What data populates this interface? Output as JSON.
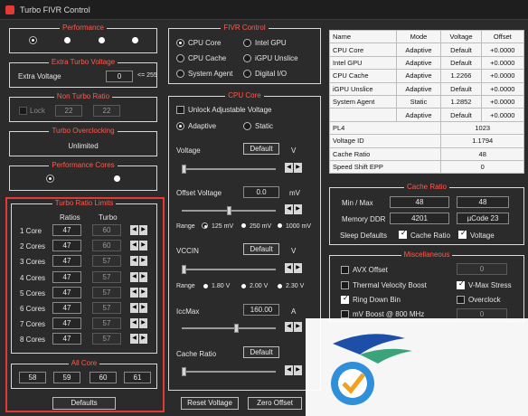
{
  "window": {
    "title": "Turbo FIVR Control"
  },
  "performance": {
    "title": "Performance"
  },
  "extra_turbo": {
    "title": "Extra Turbo Voltage",
    "label": "Extra Voltage",
    "value": "0",
    "hint": "<= 255"
  },
  "non_turbo": {
    "title": "Non Turbo Ratio",
    "lock_label": "Lock",
    "values": [
      "22",
      "22"
    ]
  },
  "turbo_oc": {
    "title": "Turbo Overclocking",
    "value": "Unlimited"
  },
  "perf_cores": {
    "title": "Performance Cores"
  },
  "turbo_limits": {
    "title": "Turbo Ratio Limits",
    "col_ratios": "Ratios",
    "col_turbo": "Turbo",
    "rows": [
      {
        "label": "1 Core",
        "ratio": "47",
        "turbo": "60"
      },
      {
        "label": "2 Cores",
        "ratio": "47",
        "turbo": "60"
      },
      {
        "label": "3 Cores",
        "ratio": "47",
        "turbo": "57"
      },
      {
        "label": "4 Cores",
        "ratio": "47",
        "turbo": "57"
      },
      {
        "label": "5 Cores",
        "ratio": "47",
        "turbo": "57"
      },
      {
        "label": "6 Cores",
        "ratio": "47",
        "turbo": "57"
      },
      {
        "label": "7 Cores",
        "ratio": "47",
        "turbo": "57"
      },
      {
        "label": "8 Cores",
        "ratio": "47",
        "turbo": "57"
      }
    ]
  },
  "all_core": {
    "title": "All Core",
    "values": [
      "58",
      "59",
      "60",
      "61"
    ]
  },
  "defaults_btn": "Defaults",
  "fivr_control": {
    "title": "FIVR Control",
    "options": [
      "CPU Core",
      "Intel GPU",
      "CPU Cache",
      "iGPU Unslice",
      "System Agent",
      "Digital I/O"
    ]
  },
  "cpu_core": {
    "title": "CPU Core",
    "unlock_label": "Unlock Adjustable Voltage",
    "mode_adaptive": "Adaptive",
    "mode_static": "Static",
    "voltage_label": "Voltage",
    "voltage_value": "Default",
    "voltage_unit": "V",
    "offset_label": "Offset Voltage",
    "offset_value": "0.0",
    "offset_unit": "mV",
    "range_label": "Range",
    "range_offset": [
      "125 mV",
      "250 mV",
      "1000 mV"
    ],
    "vccin_label": "VCCIN",
    "vccin_value": "Default",
    "vccin_unit": "V",
    "range_vccin": [
      "1.80 V",
      "2.00 V",
      "2.30 V"
    ],
    "iccmax_label": "IccMax",
    "iccmax_value": "160.00",
    "iccmax_unit": "A",
    "cache_label": "Cache Ratio",
    "cache_value": "Default"
  },
  "reset_voltage_btn": "Reset Voltage",
  "zero_offset_btn": "Zero Offset",
  "info_table": {
    "headers": [
      "Name",
      "Mode",
      "Voltage",
      "Offset"
    ],
    "rows": [
      [
        "CPU Core",
        "Adaptive",
        "Default",
        "+0.0000"
      ],
      [
        "Intel GPU",
        "Adaptive",
        "Default",
        "+0.0000"
      ],
      [
        "CPU Cache",
        "Adaptive",
        "1.2266",
        "+0.0000"
      ],
      [
        "iGPU Unslice",
        "Adaptive",
        "Default",
        "+0.0000"
      ],
      [
        "System Agent",
        "Static",
        "1.2852",
        "+0.0000"
      ],
      [
        "",
        "Adaptive",
        "Default",
        "+0.0000"
      ]
    ],
    "stats": [
      [
        "PL4",
        "1023"
      ],
      [
        "Voltage ID",
        "1.1794"
      ],
      [
        "Cache Ratio",
        "48"
      ],
      [
        "Speed Shift EPP",
        "0"
      ]
    ]
  },
  "cache_ratio": {
    "title": "Cache Ratio",
    "minmax_label": "Min / Max",
    "min": "48",
    "max": "48",
    "memory_label": "Memory DDR",
    "memory_value": "4201",
    "ucode": "µCode  23",
    "sleep_label": "Sleep Defaults",
    "sleep_cache": "Cache Ratio",
    "sleep_voltage": "Voltage"
  },
  "misc": {
    "title": "Miscellaneous",
    "avx_label": "AVX Offset",
    "avx_value": "0",
    "tvb_label": "Thermal Velocity Boost",
    "vmax_label": "V-Max Stress",
    "ringdown_label": "Ring Down Bin",
    "overclock_label": "Overclock",
    "mvboost_label": "mV Boost @ 800 MHz",
    "mvboost_value": "0"
  }
}
